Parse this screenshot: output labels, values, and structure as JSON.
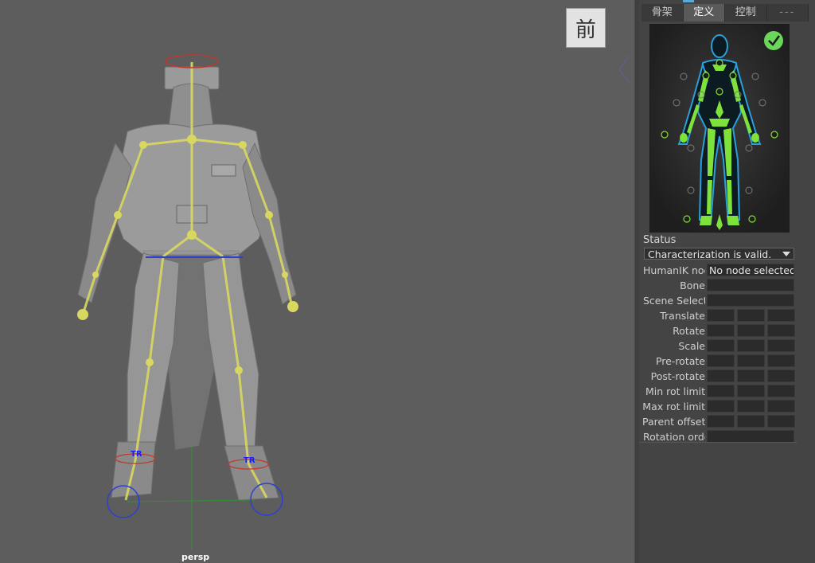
{
  "viewport": {
    "view_cube_label": "前",
    "camera_label": "persp",
    "joint_labels": [
      "TR",
      "TR"
    ]
  },
  "panel": {
    "tabs": [
      "骨架",
      "定义",
      "控制",
      "---"
    ],
    "active_tab": "定义",
    "status_label": "Status",
    "status_value": "Characterization is valid.",
    "properties": [
      {
        "label": "HumanIK noc",
        "value": "No node selected.",
        "fields": 1
      },
      {
        "label": "Bone",
        "value": "",
        "fields": 1
      },
      {
        "label": "Scene Selecti",
        "value": "",
        "fields": 1
      },
      {
        "label": "Translate",
        "value": "",
        "fields": 3
      },
      {
        "label": "Rotate",
        "value": "",
        "fields": 3
      },
      {
        "label": "Scale",
        "value": "",
        "fields": 3
      },
      {
        "label": "Pre-rotate",
        "value": "",
        "fields": 3
      },
      {
        "label": "Post-rotate",
        "value": "",
        "fields": 3
      },
      {
        "label": "Min rot limit",
        "value": "",
        "fields": 3
      },
      {
        "label": "Max rot limit",
        "value": "",
        "fields": 3
      },
      {
        "label": "Parent offset",
        "value": "",
        "fields": 3
      },
      {
        "label": "Rotation orde",
        "value": "",
        "fields": 1
      }
    ]
  },
  "colors": {
    "viewport_bg": "#5d5d5d",
    "panel_bg": "#444444",
    "skeleton": "#d8d860",
    "figure_limb": "#7ee23a",
    "figure_outline": "#2a9fd8",
    "valid_check": "#6cd65a"
  }
}
